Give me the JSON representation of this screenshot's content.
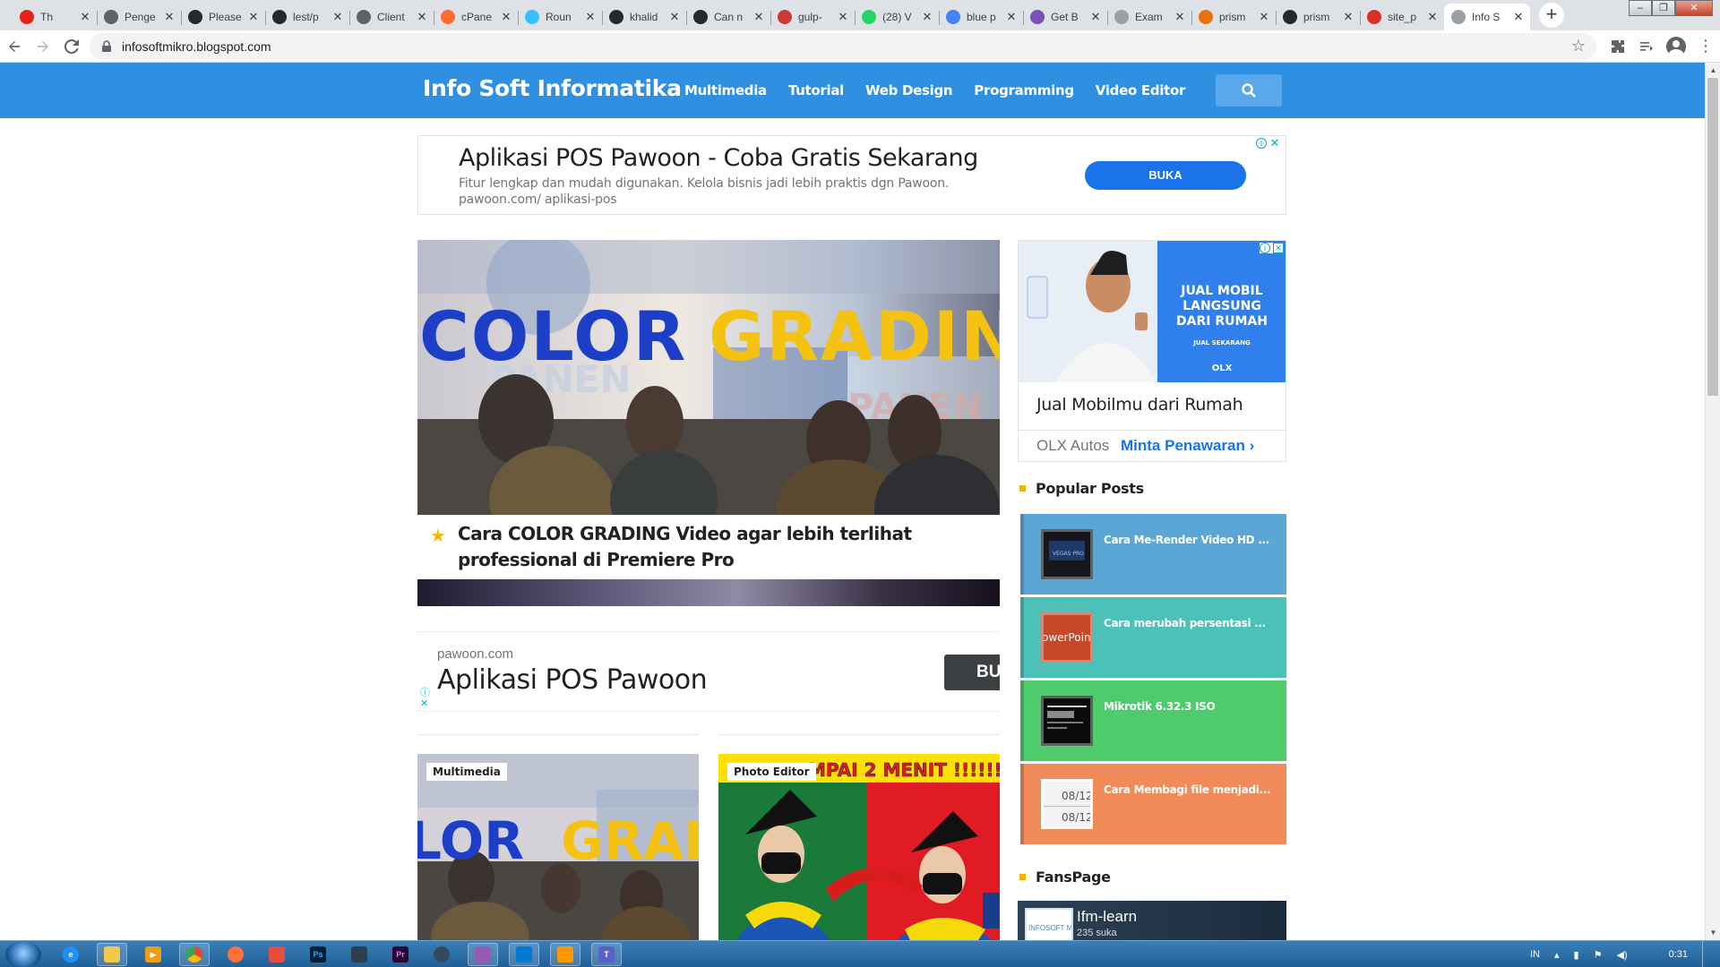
{
  "browser": {
    "tabs": [
      {
        "title": "Th",
        "favicon": "youtube-icon",
        "color": "#e62117"
      },
      {
        "title": "Penge",
        "favicon": "globe-icon",
        "color": "#5f6368"
      },
      {
        "title": "Please",
        "favicon": "github-icon",
        "color": "#24292e"
      },
      {
        "title": "lest/p",
        "favicon": "github-icon",
        "color": "#24292e"
      },
      {
        "title": "Client",
        "favicon": "globe-icon",
        "color": "#5f6368"
      },
      {
        "title": "cPane",
        "favicon": "cpanel-icon",
        "color": "#ff6c2c"
      },
      {
        "title": "Roun",
        "favicon": "roundcube-icon",
        "color": "#37beff"
      },
      {
        "title": "khalid",
        "favicon": "github-icon",
        "color": "#24292e"
      },
      {
        "title": "Can n",
        "favicon": "github-icon",
        "color": "#24292e"
      },
      {
        "title": "gulp-",
        "favicon": "npm-icon",
        "color": "#cb3837"
      },
      {
        "title": "(28) V",
        "favicon": "whatsapp-icon",
        "color": "#25d366"
      },
      {
        "title": "blue p",
        "favicon": "google-icon",
        "color": "#4285f4"
      },
      {
        "title": "Get B",
        "favicon": "bootstrap-icon",
        "color": "#7952b3"
      },
      {
        "title": "Exam",
        "favicon": "prism-icon",
        "color": "#9aa0a6"
      },
      {
        "title": "prism",
        "favicon": "code-icon",
        "color": "#e8710a"
      },
      {
        "title": "prism",
        "favicon": "github-icon",
        "color": "#24292e"
      },
      {
        "title": "site_p",
        "favicon": "shield-icon",
        "color": "#d93025"
      },
      {
        "title": "Info S",
        "favicon": "page-icon",
        "color": "#9aa0a6",
        "active": true
      }
    ],
    "new_tab": "+",
    "url": "infosoftmikro.blogspot.com"
  },
  "site": {
    "title": "Info Soft Informatika",
    "nav": [
      "Multimedia",
      "Tutorial",
      "Web Design",
      "Programming",
      "Video Editor"
    ],
    "accent": "#2f8fe0"
  },
  "ad_top": {
    "title": "Aplikasi POS Pawoon - Coba Gratis Sekarang",
    "desc": "Fitur lengkap dan mudah digunakan. Kelola bisnis jadi lebih praktis dgn Pawoon. pawoon.com/ aplikasi-pos",
    "button": "BUKA"
  },
  "featured": {
    "image_text_1": "COLOR",
    "image_text_2": "GRADING",
    "image_sign": "PANEN",
    "title": "Cara COLOR GRADING Video agar lebih terlihat professional di Premiere Pro"
  },
  "ad_mid": {
    "domain": "pawoon.com",
    "title": "Aplikasi POS Pawoon",
    "button": "BU"
  },
  "posts": [
    {
      "label": "Multimedia",
      "image_text_1": "LOR",
      "image_text_2": "GRAD"
    },
    {
      "label": "Photo Editor",
      "image_text": "MPAI 2 MENIT !!!!!!!!!"
    }
  ],
  "ad_side": {
    "banner_text": "JUAL MOBIL LANGSUNG DARI RUMAH",
    "banner_sub": "JUAL SEKARANG",
    "banner_logo": "OLX",
    "title": "Jual Mobilmu dari Rumah",
    "brand": "OLX Autos",
    "cta": "Minta Penawaran"
  },
  "popular": {
    "heading": "Popular Posts",
    "items": [
      {
        "title": "Cara Me-Render Video HD ...",
        "color": "#5ca6d6",
        "thumb_text": "VEGAS PRO"
      },
      {
        "title": "Cara merubah persentasi ...",
        "color": "#4cc1b8",
        "thumb_text": "owerPoin"
      },
      {
        "title": "Mikrotik 6.32.3 ISO",
        "color": "#4ecb6b",
        "thumb_text": ""
      },
      {
        "title": "Cara Membagi file menjadi...",
        "color": "#f18c5a",
        "thumb_text": "08/12"
      }
    ]
  },
  "fanspage": {
    "heading": "FansPage",
    "name": "Ifm-learn",
    "likes": "235 suka",
    "logo_text": "INFOSOFT M"
  },
  "taskbar": {
    "tray_lang": "IN",
    "clock": "0:31"
  }
}
